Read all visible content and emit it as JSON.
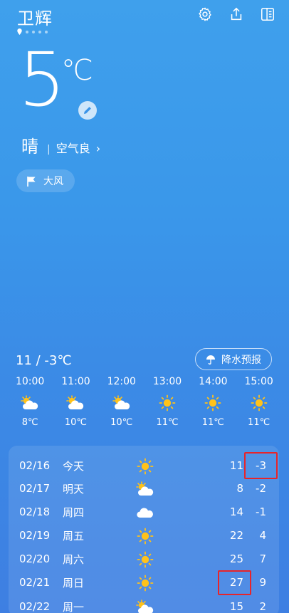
{
  "header": {
    "city": "卫辉",
    "icons": [
      "settings-icon",
      "share-icon",
      "city-list-icon"
    ]
  },
  "current": {
    "temp": "5",
    "unit": "℃",
    "condition": "晴",
    "separator": "|",
    "air_quality": "空气良",
    "chevron": "›"
  },
  "alert": {
    "label": "大风",
    "icon": "flag-icon"
  },
  "today": {
    "range": "11 / -3℃",
    "rain_forecast_label": "降水预报"
  },
  "hourly": [
    {
      "time": "10:00",
      "icon": "partly-cloudy-icon",
      "temp": "8℃"
    },
    {
      "time": "11:00",
      "icon": "partly-cloudy-icon",
      "temp": "10℃"
    },
    {
      "time": "12:00",
      "icon": "partly-cloudy-icon",
      "temp": "10℃"
    },
    {
      "time": "13:00",
      "icon": "sun-icon",
      "temp": "11℃"
    },
    {
      "time": "14:00",
      "icon": "sun-icon",
      "temp": "11℃"
    },
    {
      "time": "15:00",
      "icon": "sun-icon",
      "temp": "11℃"
    }
  ],
  "daily": [
    {
      "date": "02/16",
      "day": "今天",
      "icon": "sun-icon",
      "high": "11",
      "low": "-3"
    },
    {
      "date": "02/17",
      "day": "明天",
      "icon": "partly-cloudy-icon",
      "high": "8",
      "low": "-2"
    },
    {
      "date": "02/18",
      "day": "周四",
      "icon": "cloud-icon",
      "high": "14",
      "low": "-1"
    },
    {
      "date": "02/19",
      "day": "周五",
      "icon": "sun-icon",
      "high": "22",
      "low": "4"
    },
    {
      "date": "02/20",
      "day": "周六",
      "icon": "sun-icon",
      "high": "25",
      "low": "7"
    },
    {
      "date": "02/21",
      "day": "周日",
      "icon": "sun-icon",
      "high": "27",
      "low": "9"
    },
    {
      "date": "02/22",
      "day": "周一",
      "icon": "partly-cloudy-icon",
      "high": "15",
      "low": "2"
    }
  ],
  "colors": {
    "highlight_box": "#e8242a",
    "sun": "#ffc21a"
  }
}
